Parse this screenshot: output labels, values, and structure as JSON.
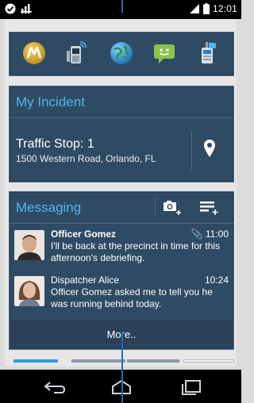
{
  "status_bar": {
    "clock": "12:01",
    "left_icons": [
      "check-circle-icon",
      "signal-bars-icon"
    ],
    "right_icons": [
      "cell-signal-icon",
      "battery-icon"
    ]
  },
  "quick_launch": {
    "icons": [
      "motorola-logo-icon",
      "radio-device-icon",
      "globe-icon",
      "chat-bubble-icon",
      "walkie-talkie-icon"
    ]
  },
  "incident": {
    "title": "My Incident",
    "incident_title": "Traffic Stop: 1",
    "address": "1500 Western Road, Orlando, FL",
    "action_icon": "map-pin-icon"
  },
  "messaging": {
    "title": "Messaging",
    "tool_icons": [
      "camera-add-icon",
      "compose-message-icon"
    ],
    "messages": [
      {
        "sender": "Officer Gomez",
        "time": "11:00",
        "body": "I'll be back at the precinct in time for this afternoon's debriefing.",
        "unread": true,
        "attachment": true
      },
      {
        "sender": "Dispatcher Alice",
        "time": "10:24",
        "body": "Officer Gomez asked me to tell you he was running behind today.",
        "unread": false,
        "attachment": false
      }
    ],
    "more_label": "More.."
  },
  "page_indicator": {
    "pages": 4,
    "active_page": 1
  },
  "nav_bar": {
    "buttons": [
      "back-icon",
      "home-icon",
      "recents-icon"
    ]
  },
  "colors": {
    "accent": "#4fb7f2",
    "card_bg": "#2f4a63",
    "callout": "#1f6fb5",
    "pager_active": "#2f9ae0"
  }
}
